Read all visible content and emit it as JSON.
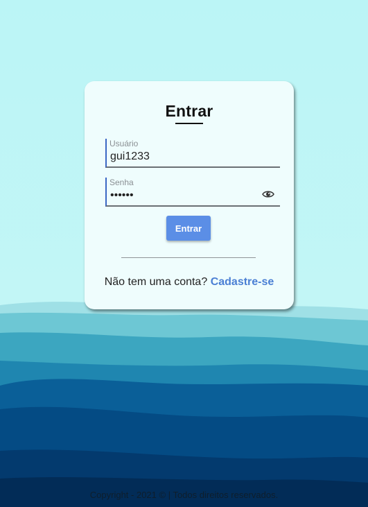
{
  "login": {
    "title": "Entrar",
    "username_label": "Usuário",
    "username_value": "gui1233",
    "password_label": "Senha",
    "password_value": "••••••",
    "submit_label": "Entrar",
    "signup_prompt": "Não tem uma conta?",
    "signup_link": "Cadastre-se",
    "password_toggle_icon": "eye-icon"
  },
  "footer": {
    "text": "Copyright - 2021 © | Todos direitos reservados."
  },
  "colors": {
    "sky": "#bdf5f6",
    "card": "#effdfd",
    "accent": "#5b8ee6",
    "link": "#4a7fd4"
  }
}
